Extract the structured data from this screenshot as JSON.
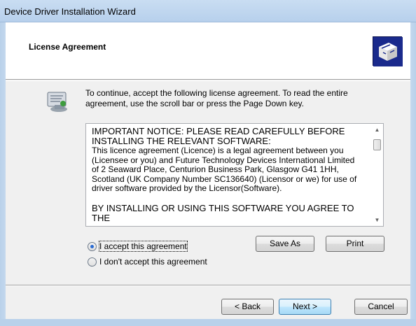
{
  "window": {
    "title": "Device Driver Installation Wizard"
  },
  "header": {
    "heading": "License Agreement",
    "icon": "wizard-box-icon"
  },
  "intro": {
    "icon": "license-icon",
    "text": "To continue, accept the following license agreement. To read the entire agreement, use the scroll bar or press the Page Down key."
  },
  "license": {
    "heading_line1": "IMPORTANT NOTICE: PLEASE READ CAREFULLY BEFORE",
    "heading_line2": "INSTALLING THE RELEVANT SOFTWARE:",
    "para_line1": "This licence agreement (Licence) is a legal agreement between you",
    "para_line2": "(Licensee or you) and Future Technology Devices International Limited",
    "para_line3": "of 2 Seaward Place, Centurion Business Park, Glasgow G41 1HH,",
    "para_line4": "Scotland (UK Company Number SC136640) (Licensor or we) for use of",
    "para_line5": "driver software provided by the Licensor(Software).",
    "tail_line": "BY INSTALLING OR USING THIS SOFTWARE YOU AGREE TO THE"
  },
  "options": {
    "accept_label": "I accept this agreement",
    "decline_label": "I don't accept this agreement",
    "selected": "accept"
  },
  "buttons": {
    "save_as": "Save As",
    "print": "Print",
    "back": "< Back",
    "next": "Next >",
    "cancel": "Cancel"
  }
}
